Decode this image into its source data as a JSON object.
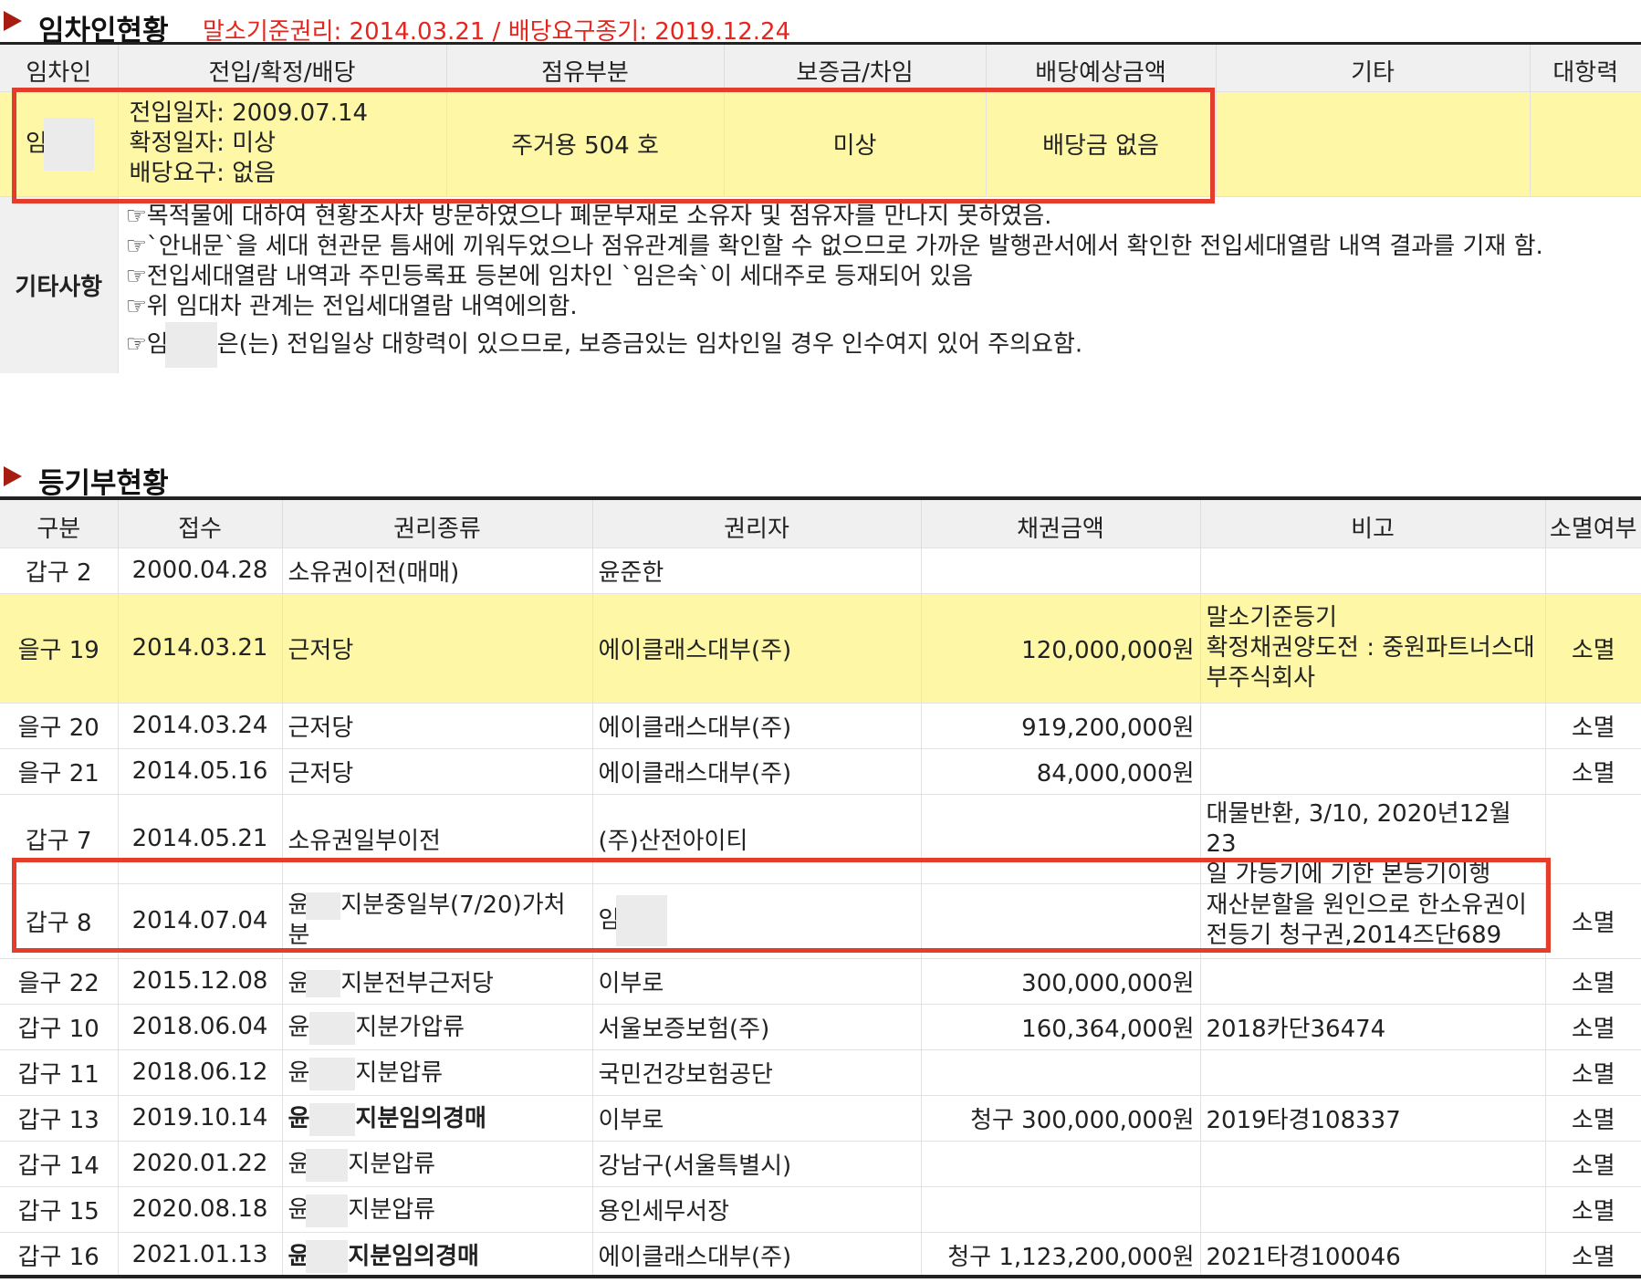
{
  "tenant_section": {
    "title": "임차인현황",
    "subtitle": "말소기준권리: 2014.03.21 / 배당요구종기: 2019.12.24",
    "headers": [
      "임차인",
      "전입/확정/배당",
      "점유부분",
      "보증금/차임",
      "배당예상금액",
      "기타",
      "대항력"
    ],
    "row": {
      "name": "임",
      "move_in": "전입일자: 2009.07.14",
      "fixed_date": "확정일자: 미상",
      "dividend_request": "배당요구: 없음",
      "occupied_part": "주거용 504 호",
      "deposit": "미상",
      "expected_dividend": "배당금 없음",
      "etc": "",
      "opposing_power": ""
    },
    "notes_label": "기타사항",
    "notes": [
      "☞목적물에 대하여 현황조사차 방문하였으나 폐문부재로 소유자 및 점유자를 만나지 못하였음.",
      "☞`안내문`을 세대 현관문 틈새에 끼워두었으나 점유관계를 확인할 수 없으므로 가까운 발행관서에서 확인한 전입세대열람 내역 결과를 기재 함.",
      "☞전입세대열람 내역과 주민등록표 등본에 임차인 `임은숙`이 세대주로 등재되어 있음",
      "☞위 임대차 관계는 전입세대열람 내역에의함.",
      "☞임은(는) 전입일상 대항력이 있으므로, 보증금있는 임차인일 경우 인수여지 있어 주의요함."
    ]
  },
  "registry_section": {
    "title": "등기부현황",
    "headers": [
      "구분",
      "접수",
      "권리종류",
      "권리자",
      "채권금액",
      "비고",
      "소멸여부"
    ],
    "rows": [
      {
        "type": "갑구 2",
        "date": "2000.04.28",
        "right": "소유권이전(매매)",
        "holder": "윤준한",
        "amount": "",
        "note": "",
        "status": ""
      },
      {
        "type": "을구 19",
        "date": "2014.03.21",
        "right": "근저당",
        "holder": "에이클래스대부(주)",
        "amount": "120,000,000원",
        "note": "말소기준등기\n확정채권양도전 : 중원파트너스대부주식회사",
        "status": "소멸"
      },
      {
        "type": "을구 20",
        "date": "2014.03.24",
        "right": "근저당",
        "holder": "에이클래스대부(주)",
        "amount": "919,200,000원",
        "note": "",
        "status": "소멸"
      },
      {
        "type": "을구 21",
        "date": "2014.05.16",
        "right": "근저당",
        "holder": "에이클래스대부(주)",
        "amount": "84,000,000원",
        "note": "",
        "status": "소멸"
      },
      {
        "type": "갑구 7",
        "date": "2014.05.21",
        "right": "소유권일부이전",
        "holder": "(주)산전아이티",
        "amount": "",
        "note": "대물반환, 3/10, 2020년12월23일 가등기에 기한 본등기이행",
        "status": ""
      },
      {
        "type": "갑구 8",
        "date": "2014.07.04",
        "right": "윤 지분중일부(7/20)가처분",
        "holder": "임",
        "amount": "",
        "note": "재산분할을 원인으로 한소유권이전등기 청구권,2014즈단689",
        "status": "소멸"
      },
      {
        "type": "을구 22",
        "date": "2015.12.08",
        "right": "윤 지분전부근저당",
        "holder": "이부로",
        "amount": "300,000,000원",
        "note": "",
        "status": "소멸"
      },
      {
        "type": "갑구 10",
        "date": "2018.06.04",
        "right": "윤 지분가압류",
        "holder": "서울보증보험(주)",
        "amount": "160,364,000원",
        "note": "2018카단36474",
        "status": "소멸"
      },
      {
        "type": "갑구 11",
        "date": "2018.06.12",
        "right": "윤 지분압류",
        "holder": "국민건강보험공단",
        "amount": "",
        "note": "",
        "status": "소멸"
      },
      {
        "type": "갑구 13",
        "date": "2019.10.14",
        "right": "윤 지분임의경매",
        "holder": "이부로",
        "amount": "청구 300,000,000원",
        "note": "2019타경108337",
        "status": "소멸"
      },
      {
        "type": "갑구 14",
        "date": "2020.01.22",
        "right": "윤 지분압류",
        "holder": "강남구(서울특별시)",
        "amount": "",
        "note": "",
        "status": "소멸"
      },
      {
        "type": "갑구 15",
        "date": "2020.08.18",
        "right": "윤 지분압류",
        "holder": "용인세무서장",
        "amount": "",
        "note": "",
        "status": "소멸"
      },
      {
        "type": "갑구 16",
        "date": "2021.01.13",
        "right": "윤 지분임의경매",
        "holder": "에이클래스대부(주)",
        "amount": "청구 1,123,200,000원",
        "note": "2021타경100046",
        "status": "소멸"
      }
    ],
    "row_parts": {
      "r8_right_a": "윤",
      "r8_right_b": "지분중일부(7/20)가처",
      "r8_right_c": "분",
      "r19_note_a": "말소기준등기",
      "r19_note_b": "확정채권양도전 : 중원파트너스대",
      "r19_note_c": "부주식회사",
      "r7_note_a": "대물반환, 3/10, 2020년12월23",
      "r7_note_b": "일 가등기에 기한 본등기이행",
      "r8_note_a": "재산분할을 원인으로 한소유권이",
      "r8_note_b": "전등기 청구권,2014즈단689",
      "yun": "윤",
      "r22_suffix": "지분전부근저당",
      "r10_suffix": "지분가압류",
      "r11_suffix": "지분압류",
      "r13_suffix": "지분임의경매",
      "r14_suffix": "지분압류",
      "r15_suffix": "지분압류",
      "r16_suffix": "지분임의경매",
      "note5_a": "☞임",
      "note5_b": "은(는) 전입일상 대항력이 있으므로, 보증금있는 임차인일 경우 인수여지 있어 주의요함."
    }
  },
  "colors": {
    "accent_red": "#e8251d",
    "highlight": "#fdf7a6",
    "box_red": "#e33e2c"
  }
}
